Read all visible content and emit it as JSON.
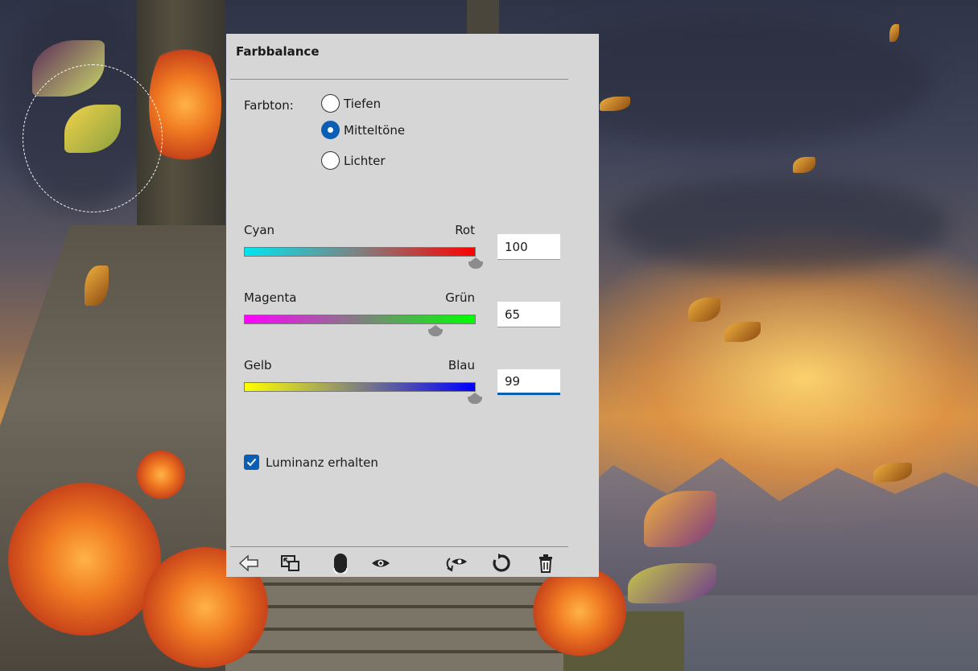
{
  "panel": {
    "title": "Farbbalance"
  },
  "tone": {
    "label": "Farbton:",
    "options": [
      {
        "label": "Tiefen",
        "checked": false
      },
      {
        "label": "Mitteltöne",
        "checked": true
      },
      {
        "label": "Lichter",
        "checked": false
      }
    ]
  },
  "sliders": [
    {
      "left_label": "Cyan",
      "right_label": "Rot",
      "value": "100",
      "min": -100,
      "max": 100,
      "gradient": [
        "#00e5f0",
        "#ff0000"
      ]
    },
    {
      "left_label": "Magenta",
      "right_label": "Grün",
      "value": "65",
      "min": -100,
      "max": 100,
      "gradient": [
        "#ff00ff",
        "#00ff00"
      ]
    },
    {
      "left_label": "Gelb",
      "right_label": "Blau",
      "value": "99",
      "min": -100,
      "max": 100,
      "gradient": [
        "#ffff00",
        "#0000ff"
      ]
    }
  ],
  "preserve_luminosity": {
    "label": "Luminanz erhalten",
    "checked": true
  },
  "footer_icons": [
    "clip-to-layer-icon",
    "reset-view-icon",
    "layer-mask-icon",
    "visibility-eye-icon",
    "previous-state-icon",
    "reset-icon",
    "delete-icon"
  ],
  "colors": {
    "panel_bg": "#d6d6d6",
    "accent": "#0a5fb4"
  }
}
